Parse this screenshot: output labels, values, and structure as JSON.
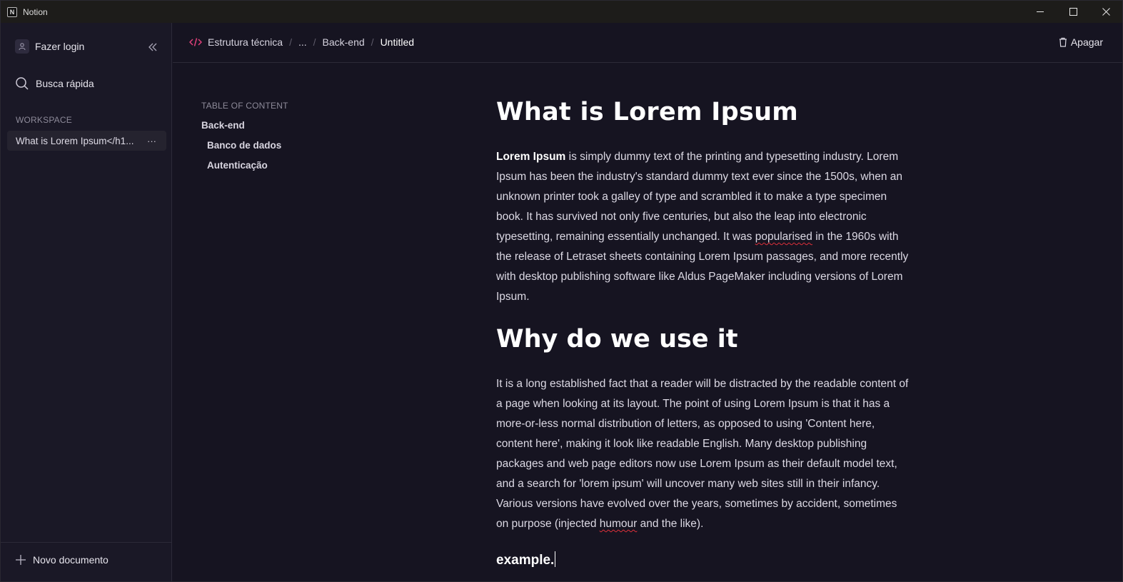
{
  "window": {
    "app_title": "Notion",
    "app_logo_letter": "N",
    "controls": {
      "minimize": "—",
      "maximize": "☐",
      "close": "✕"
    }
  },
  "sidebar": {
    "login_label": "Fazer login",
    "search_label": "Busca rápida",
    "workspace_label": "WORKSPACE",
    "workspace_items": [
      {
        "label": "What is Lorem Ipsum</h1...",
        "more": "···"
      }
    ],
    "new_document_label": "Novo documento"
  },
  "header": {
    "breadcrumb": [
      "Estrutura técnica",
      "...",
      "Back-end",
      "Untitled"
    ],
    "breadcrumb_separator": "/",
    "delete_label": "Apagar"
  },
  "toc": {
    "title": "TABLE OF CONTENT",
    "items": [
      {
        "label": "Back-end",
        "level": 1
      },
      {
        "label": "Banco de dados",
        "level": 2
      },
      {
        "label": "Autenticação",
        "level": 2
      }
    ]
  },
  "document": {
    "heading1": "What is Lorem Ipsum",
    "para1_bold": "Lorem Ipsum",
    "para1_a": " is simply dummy text of the printing and typesetting industry. Lorem Ipsum has been the industry's standard dummy text ever since the 1500s, when an unknown printer took a galley of type and scrambled it to make a type specimen book. It has survived not only five centuries, but also the leap into electronic typesetting, remaining essentially unchanged. It was ",
    "para1_misspelled": "popularised",
    "para1_b": " in the 1960s with the release of Letraset sheets containing Lorem Ipsum passages, and more recently with desktop publishing software like Aldus PageMaker including versions of Lorem Ipsum.",
    "heading2": "Why do we use it",
    "para2_a": "It is a long established fact that a reader will be distracted by the readable content of a page when looking at its layout. The point of using Lorem Ipsum is that it has a more-or-less normal distribution of letters, as opposed to using 'Content here, content here', making it look like readable English. Many desktop publishing packages and web page editors now use Lorem Ipsum as their default model text, and a search for 'lorem ipsum' will uncover many web sites still in their infancy. Various versions have evolved over the years, sometimes by accident, sometimes on purpose (injected ",
    "para2_misspelled": "humour",
    "para2_b": " and the like).",
    "heading3": "example."
  },
  "colors": {
    "background": "#161421",
    "sidebar": "#1a1826",
    "accent_code_icon": "#e0407a",
    "spellcheck": "#e0303a"
  },
  "icons": [
    "user-icon",
    "collapse-sidebar-icon",
    "search-icon",
    "plus-icon",
    "code-icon",
    "trash-icon"
  ]
}
